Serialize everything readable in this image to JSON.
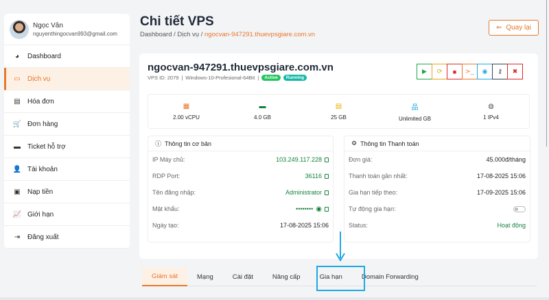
{
  "user": {
    "name": "Ngọc Vân",
    "email": "nguyenthingocvan993@gmail.com"
  },
  "sidebar": {
    "items": [
      {
        "label": "Dashboard",
        "icon": "gauge-icon",
        "glyph": "◕"
      },
      {
        "label": "Dịch vụ",
        "icon": "server-icon",
        "glyph": "▭"
      },
      {
        "label": "Hóa đơn",
        "icon": "file-invoice-icon",
        "glyph": "▤"
      },
      {
        "label": "Đơn hàng",
        "icon": "shopping-cart-icon",
        "glyph": "🛒"
      },
      {
        "label": "Ticket hỗ trợ",
        "icon": "ticket-icon",
        "glyph": "▬"
      },
      {
        "label": "Tài khoản",
        "icon": "user-icon",
        "glyph": "👤"
      },
      {
        "label": "Nạp tiền",
        "icon": "wallet-icon",
        "glyph": "▣"
      },
      {
        "label": "Giới hạn",
        "icon": "chart-line-icon",
        "glyph": "📈"
      },
      {
        "label": "Đăng xuất",
        "icon": "logout-icon",
        "glyph": "⇥"
      }
    ]
  },
  "page": {
    "title": "Chi tiết VPS",
    "back_label": "Quay lại"
  },
  "breadcrumb": {
    "items": [
      "Dashboard",
      "Dịch vụ",
      "ngocvan-947291.thuevpsgiare.com.vn"
    ],
    "sep": "/"
  },
  "vps": {
    "hostname": "ngocvan-947291.thuevpsgiare.com.vn",
    "id_text": "VPS ID: 2079",
    "os": "Windows-10-Profesional-64Bit",
    "sep": "|",
    "badges": [
      "Active",
      "Running"
    ]
  },
  "actions": [
    {
      "name": "start-icon",
      "glyph": "▶",
      "color": "#22a34a"
    },
    {
      "name": "restart-icon",
      "glyph": "⟳",
      "color": "#e8a317"
    },
    {
      "name": "stop-icon",
      "glyph": "■",
      "color": "#dc2626"
    },
    {
      "name": "console-icon",
      "glyph": "≻_",
      "color": "#e8762b"
    },
    {
      "name": "reinstall-icon",
      "glyph": "◉",
      "color": "#1ea7e1"
    },
    {
      "name": "key-icon",
      "glyph": "⚷",
      "color": "#374151"
    },
    {
      "name": "destroy-icon",
      "glyph": "✖",
      "color": "#dc2626"
    }
  ],
  "stats": [
    {
      "value": "2.00 vCPU",
      "icon": "cpu-icon",
      "glyph": "▦",
      "color": "#e8762b"
    },
    {
      "value": "4.0 GB",
      "icon": "memory-icon",
      "glyph": "▬",
      "color": "#15803d"
    },
    {
      "value": "25 GB",
      "icon": "hdd-icon",
      "glyph": "▤",
      "color": "#eab308"
    },
    {
      "value": "Unlimited GB",
      "icon": "network-icon",
      "glyph": "品",
      "color": "#1ea7e1"
    },
    {
      "value": "1 IPv4",
      "icon": "globe-icon",
      "glyph": "◍",
      "color": "#555"
    }
  ],
  "basic": {
    "title": "Thông tin cơ bản",
    "rows": [
      {
        "k": "IP Máy chủ:",
        "v": "103.249.117.228"
      },
      {
        "k": "RDP Port:",
        "v": "36116"
      },
      {
        "k": "Tên đăng nhập:",
        "v": "Administrator"
      },
      {
        "k": "Mật khẩu:",
        "v": "••••••••"
      },
      {
        "k": "Ngày tạo:",
        "v": "17-08-2025 15:06"
      }
    ]
  },
  "payment": {
    "title": "Thông tin Thanh toán",
    "rows": [
      {
        "k": "Đơn giá:",
        "v": "45.000đ/tháng"
      },
      {
        "k": "Thanh toán gần nhất:",
        "v": "17-08-2025 15:06"
      },
      {
        "k": "Gia hạn tiếp theo:",
        "v": "17-09-2025 15:06"
      },
      {
        "k": "Tự động gia hạn:",
        "v": ""
      },
      {
        "k": "Status:",
        "v": "Hoạt động"
      }
    ]
  },
  "tabs": [
    "Giám sát",
    "Mạng",
    "Cài đặt",
    "Nâng cấp",
    "Gia hạn",
    "Domain Forwarding"
  ],
  "colors": {
    "accent": "#e8762b",
    "success": "#15803d",
    "highlight": "#1ea7e1",
    "active_badge": "#22c55e",
    "running_badge": "#14b8a6"
  }
}
